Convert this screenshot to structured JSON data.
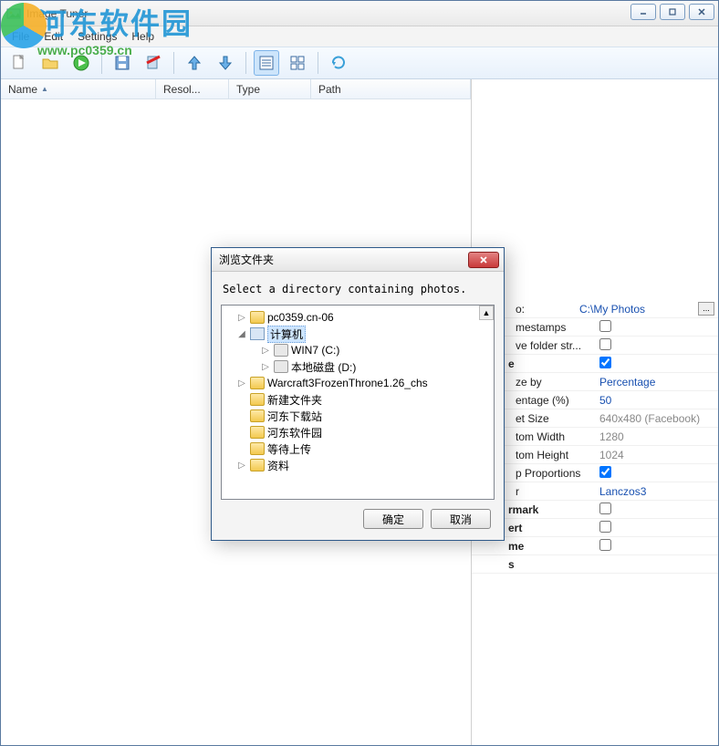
{
  "app": {
    "title": "Image Tuner"
  },
  "menu": {
    "file": "File",
    "edit": "Edit",
    "settings": "Settings",
    "help": "Help"
  },
  "watermark": {
    "text": "河东软件园",
    "url": "www.pc0359.cn"
  },
  "columns": {
    "name": "Name",
    "resol": "Resol...",
    "type": "Type",
    "path": "Path"
  },
  "props": {
    "save_to": {
      "label": "o:",
      "value": "C:\\My Photos"
    },
    "timestamps": {
      "label": "mestamps"
    },
    "folder_str": {
      "label": "ve folder str..."
    },
    "resize_section": {
      "label": "e"
    },
    "resize_by": {
      "label": "ze by",
      "value": "Percentage"
    },
    "percentage": {
      "label": "entage (%)",
      "value": "50"
    },
    "set_size": {
      "label": "et Size",
      "value": "640x480 (Facebook)"
    },
    "custom_w": {
      "label": "tom Width",
      "value": "1280"
    },
    "custom_h": {
      "label": "tom Height",
      "value": "1024"
    },
    "keep_prop": {
      "label": "p Proportions"
    },
    "filter": {
      "label": "r",
      "value": "Lanczos3"
    },
    "watermark_s": {
      "label": "rmark"
    },
    "convert_s": {
      "label": "ert"
    },
    "rename_s": {
      "label": "me"
    },
    "misc_s": {
      "label": "s"
    }
  },
  "dialog": {
    "title": "浏览文件夹",
    "message": "Select a directory containing photos.",
    "ok": "确定",
    "cancel": "取消",
    "tree": {
      "n0": "pc0359.cn-06",
      "n1": "计算机",
      "n1a": "WIN7 (C:)",
      "n1b": "本地磁盘 (D:)",
      "n2": "Warcraft3FrozenThrone1.26_chs",
      "n3": "新建文件夹",
      "n4": "河东下载站",
      "n5": "河东软件园",
      "n6": "等待上传",
      "n7": "资料"
    }
  }
}
